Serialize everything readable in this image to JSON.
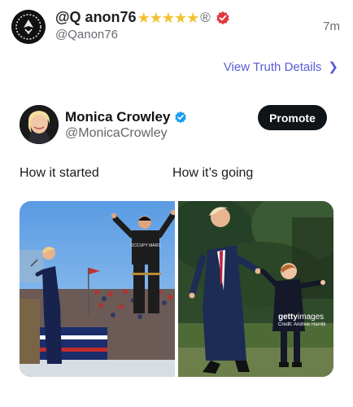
{
  "post": {
    "display_name": "@Q anon76",
    "name_stars": "★★★★★",
    "name_reg": "®",
    "handle": "@Qanon76",
    "timestamp": "7m",
    "view_details_label": "View Truth Details",
    "chevron_glyph": "❯"
  },
  "embedded": {
    "author_name": "Monica Crowley",
    "author_handle": "@MonicaCrowley",
    "promote_label": "Promote",
    "caption_left": "How it started",
    "caption_right": "How it’s going",
    "image_right_watermark": {
      "brand_bold": "getty",
      "brand_light": "images",
      "credit": "Credit: Andrew Harnik"
    },
    "image_left_shirt_text": "OCCUPY MARS"
  },
  "colors": {
    "link": "#5b5bd6",
    "verified_red": "#e0393e",
    "verified_blue": "#1d9bf0",
    "star": "#f2c12e",
    "promote_bg": "#0f1419"
  }
}
